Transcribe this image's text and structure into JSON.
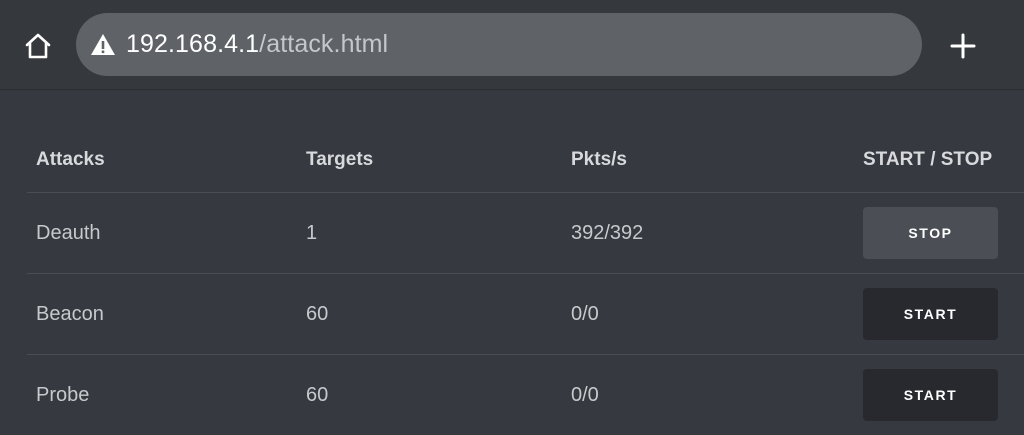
{
  "browser": {
    "url_host": "192.168.4.1",
    "url_path": "/attack.html",
    "home_icon": "home-icon",
    "warning_icon": "warning-icon",
    "new_tab_icon": "plus-icon"
  },
  "table": {
    "headers": {
      "attacks": "Attacks",
      "targets": "Targets",
      "pkts": "Pkts/s",
      "control": "START / STOP"
    },
    "rows": [
      {
        "attack": "Deauth",
        "targets": "1",
        "pkts": "392/392",
        "button": "STOP"
      },
      {
        "attack": "Beacon",
        "targets": "60",
        "pkts": "0/0",
        "button": "START"
      },
      {
        "attack": "Probe",
        "targets": "60",
        "pkts": "0/0",
        "button": "START"
      }
    ]
  },
  "colors": {
    "background": "#36393f",
    "url_bar": "#5f6267",
    "stop_button": "#4b4e55",
    "start_button": "#27292e"
  }
}
